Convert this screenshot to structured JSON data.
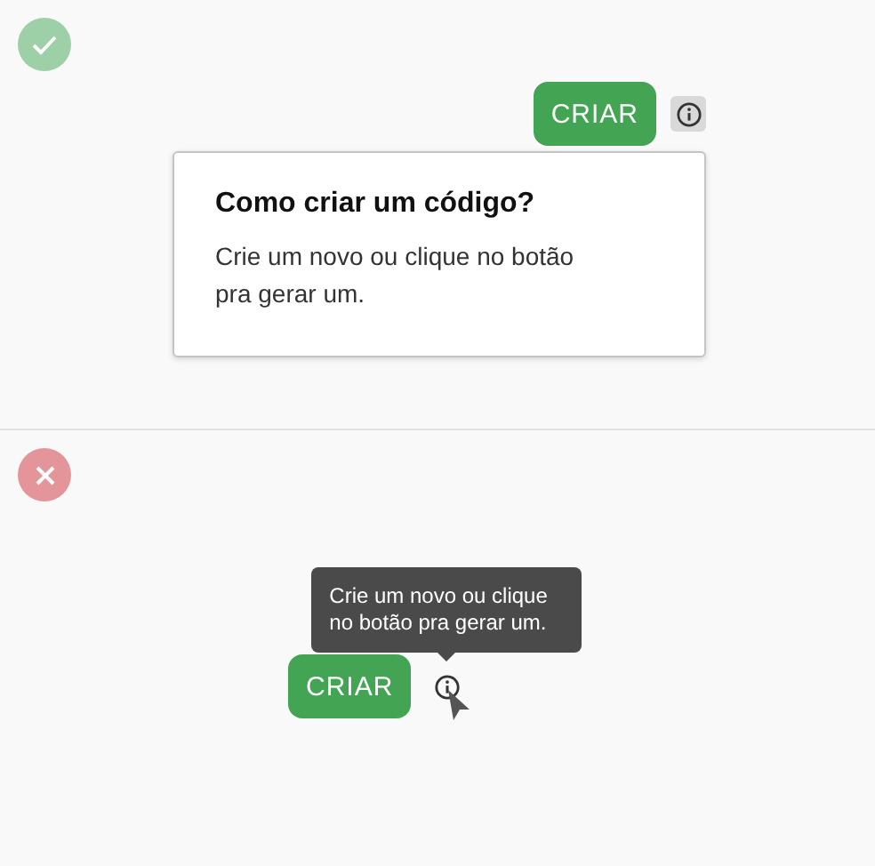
{
  "examples": [
    {
      "kind": "good",
      "button": "CRIAR",
      "info_active": true,
      "popover": {
        "title": "Como criar um código?",
        "body": "Crie um novo ou clique no botão pra gerar um."
      }
    },
    {
      "kind": "bad",
      "button": "CRIAR",
      "info_active": false,
      "tooltip": "Crie um novo ou clique no botão pra gerar um."
    }
  ]
}
